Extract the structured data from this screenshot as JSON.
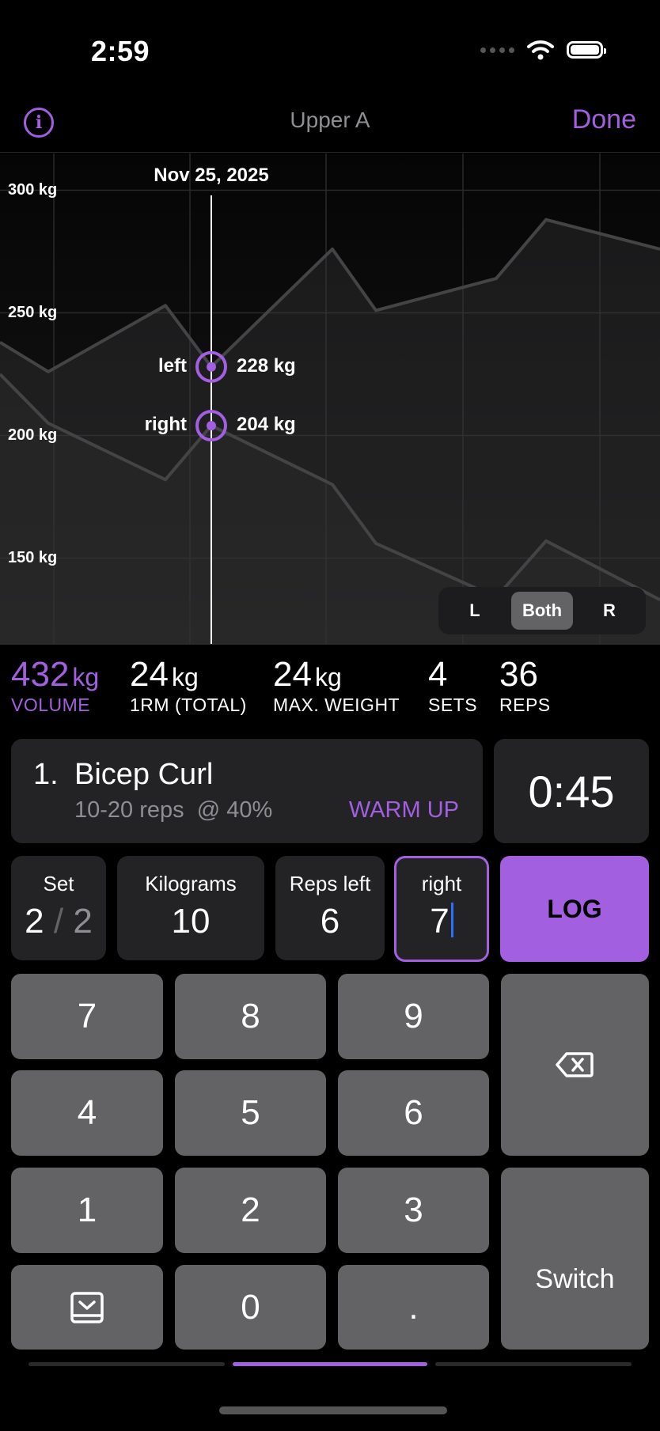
{
  "status_bar": {
    "time": "2:59"
  },
  "nav": {
    "title": "Upper A",
    "done_label": "Done",
    "info_glyph": "i"
  },
  "chart_data": {
    "type": "line",
    "y_unit": "kg",
    "ylim": [
      115,
      315
    ],
    "y_ticks": [
      "300 kg",
      "250 kg",
      "200 kg",
      "150 kg"
    ],
    "y_tick_values": [
      300,
      250,
      200,
      150
    ],
    "selected_date": "Nov 25, 2025",
    "series": [
      {
        "name": "left",
        "values": [
          238,
          226,
          253,
          228,
          276,
          251,
          264,
          288,
          276
        ],
        "point_label": "228 kg"
      },
      {
        "name": "right",
        "values": [
          225,
          205,
          182,
          204,
          180,
          156,
          134,
          157,
          133
        ],
        "point_label": "204 kg"
      }
    ],
    "colors": {
      "line": "#444446",
      "selected": "#a25fe0",
      "cursor": "#ffffff"
    },
    "grid": true
  },
  "segmented": {
    "items": [
      "L",
      "Both",
      "R"
    ],
    "selected": "Both"
  },
  "stats": [
    {
      "value": "432",
      "unit": "kg",
      "label": "VOLUME"
    },
    {
      "value": "24",
      "unit": "kg",
      "label": "1RM (TOTAL)"
    },
    {
      "value": "24",
      "unit": "kg",
      "label": "MAX. WEIGHT"
    },
    {
      "value": "4",
      "unit": "",
      "label": "SETS"
    },
    {
      "value": "36",
      "unit": "",
      "label": "REPS"
    }
  ],
  "exercise": {
    "number": "1.",
    "name": "Bicep Curl",
    "detail": "10-20 reps  @ 40%",
    "tag": "WARM UP"
  },
  "timer": "0:45",
  "inputs": {
    "set_label": "Set",
    "set_current": "2",
    "set_sep": "/",
    "set_total": "2",
    "kg_label": "Kilograms",
    "kg_value": "10",
    "reps_left_label": "Reps left",
    "reps_left_value": "6",
    "right_label": "right",
    "right_value": "7"
  },
  "log_label": "LOG",
  "keypad": {
    "keys": [
      "7",
      "8",
      "9",
      "4",
      "5",
      "6",
      "1",
      "2",
      "3",
      "0",
      "."
    ],
    "switch_label": "Switch"
  },
  "colors": {
    "accent": "#a25fe0",
    "key": "#636366",
    "card": "#232325"
  }
}
